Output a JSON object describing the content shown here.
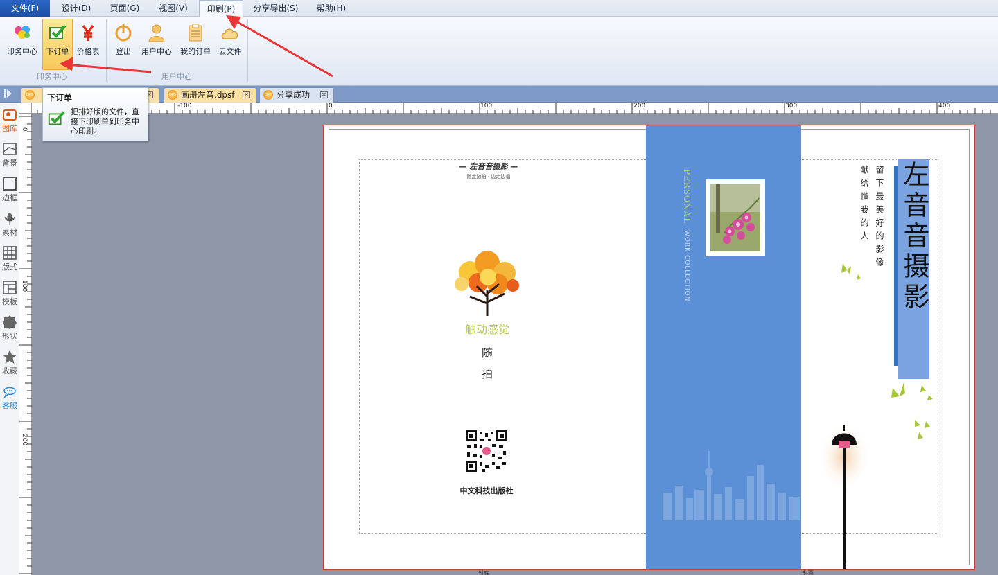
{
  "menu": {
    "file": "文件(F)",
    "design": "设计(D)",
    "page": "页面(G)",
    "view": "视图(V)",
    "print": "印刷(P)",
    "share_export": "分享导出(S)",
    "help": "帮助(H)"
  },
  "ribbon": {
    "print_center": "印务中心",
    "place_order": "下订单",
    "price_list": "价格表",
    "group_print_center": "印务中心",
    "logout": "登出",
    "user_center": "用户中心",
    "my_orders": "我的订单",
    "cloud_files": "云文件",
    "group_user_center": "用户中心"
  },
  "tabs": [
    {
      "label": "画册左音.dpsf"
    },
    {
      "label": "分享成功"
    }
  ],
  "tab_icon_text": "DPS",
  "tooltip": {
    "title": "下订单",
    "body": "把排好版的文件，直接下印刷单到印务中心印刷。"
  },
  "left_tools": {
    "gallery": "图库",
    "background": "背景",
    "border": "边框",
    "material": "素材",
    "layout": "版式",
    "template": "模板",
    "shape": "形状",
    "favorite": "收藏",
    "service": "客服"
  },
  "ruler": {
    "top_labels": [
      "-100",
      "0",
      "100",
      "200",
      "300",
      "400"
    ],
    "left_labels": [
      "0",
      "100",
      "200"
    ]
  },
  "page": {
    "back_header": "— 左音音摄影 —",
    "back_subheader": "随走随拍 · 边走边唱",
    "back_green_text": "触动感觉",
    "back_char_1": "随",
    "back_char_2": "拍",
    "publisher": "中文科技出版社",
    "spine_personal": "PERSONAL",
    "spine_work": "WORK COLLECTION",
    "cover_title": "左音音摄影",
    "cover_poem_1": "留下最美好的影像",
    "cover_poem_2": "献给懂我的人",
    "label_back": "封底",
    "label_front": "封面"
  },
  "colors": {
    "spine": "#5b8fd6",
    "accent_green": "#a8c63a",
    "title_bg": "#7aa3e0",
    "arrow_red": "#e83535"
  }
}
